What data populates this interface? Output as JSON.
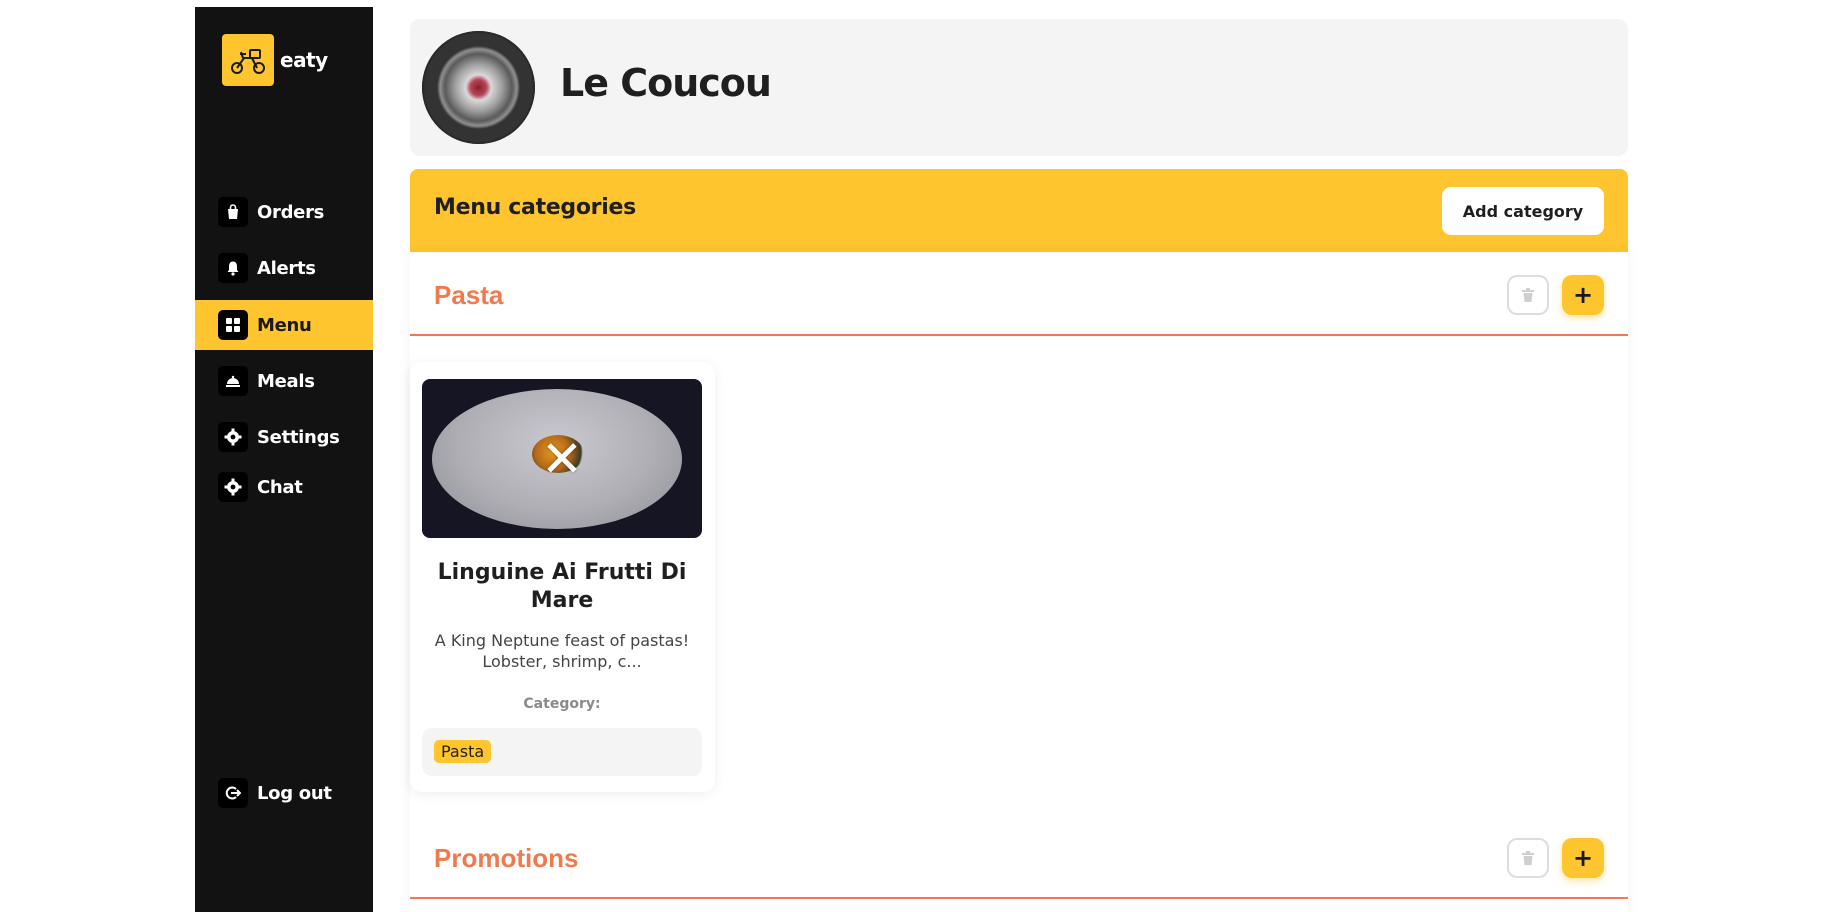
{
  "app": {
    "logo_text": "eaty"
  },
  "sidebar": {
    "items": [
      {
        "label": "Orders",
        "icon": "shopping-bag-icon"
      },
      {
        "label": "Alerts",
        "icon": "bell-icon"
      },
      {
        "label": "Menu",
        "icon": "grid-icon",
        "active": true
      },
      {
        "label": "Meals",
        "icon": "cloche-icon"
      },
      {
        "label": "Settings",
        "icon": "gear-icon"
      },
      {
        "label": "Chat",
        "icon": "gear-icon"
      }
    ],
    "logout_label": "Log out"
  },
  "header": {
    "restaurant_name": "Le Coucou"
  },
  "categories_bar": {
    "title": "Menu categories",
    "add_button": "Add category"
  },
  "sections": [
    {
      "title": "Pasta",
      "meals": [
        {
          "name": "Linguine Ai Frutti Di Mare",
          "description": "A King Neptune feast of pastas! Lobster, shrimp, c...",
          "category_label": "Category:",
          "category_tag": "Pasta",
          "remove_symbol": "✕"
        }
      ]
    },
    {
      "title": "Promotions",
      "meals": []
    }
  ],
  "buttons": {
    "add_symbol": "+"
  },
  "colors": {
    "accent": "#ffc52e",
    "section_title": "#f07a4f",
    "sidebar_bg": "#121212"
  }
}
